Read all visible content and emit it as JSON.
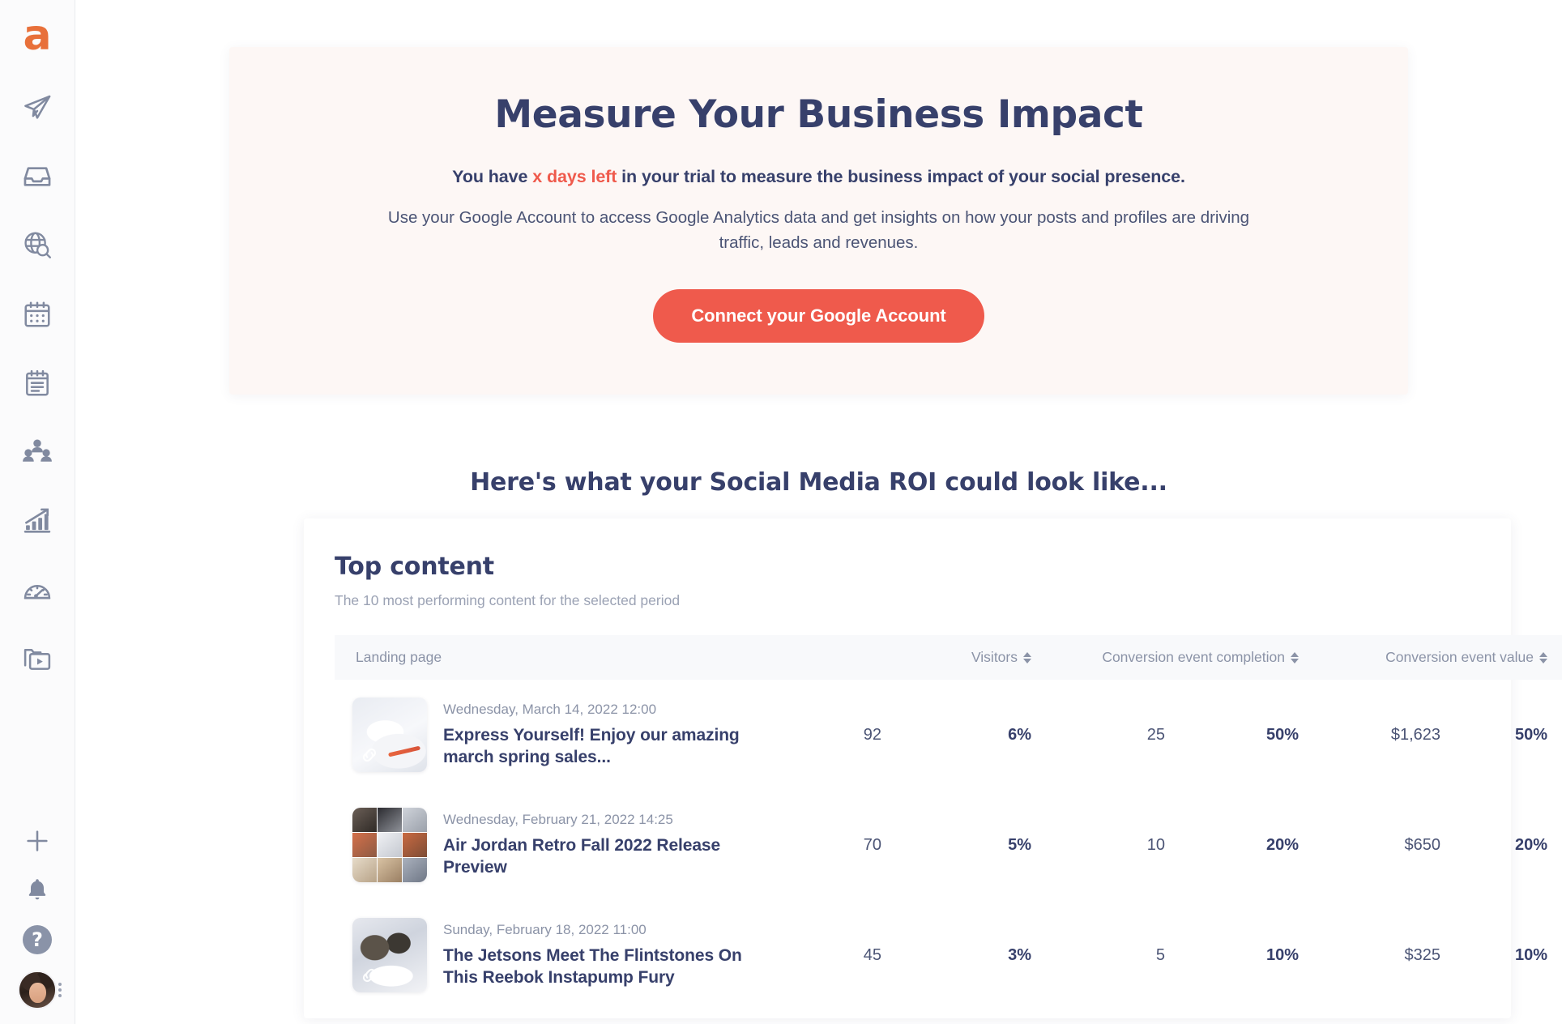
{
  "brand": {
    "logo_letter": "a",
    "logo_color": "#e8703a",
    "accent_color": "#ef5a4c",
    "heading_color": "#37406b"
  },
  "sidebar": {
    "items": [
      {
        "name": "publish-icon",
        "label": "Publish"
      },
      {
        "name": "inbox-icon",
        "label": "Inbox"
      },
      {
        "name": "listening-icon",
        "label": "Listening"
      },
      {
        "name": "calendar-icon",
        "label": "Calendar"
      },
      {
        "name": "notes-icon",
        "label": "Notes"
      },
      {
        "name": "audience-icon",
        "label": "Audience"
      },
      {
        "name": "analytics-icon",
        "label": "Analytics"
      },
      {
        "name": "performance-icon",
        "label": "Performance"
      },
      {
        "name": "media-library-icon",
        "label": "Media library"
      }
    ],
    "bottom": [
      {
        "name": "add-icon",
        "label": "Create"
      },
      {
        "name": "bell-icon",
        "label": "Notifications"
      },
      {
        "name": "help-icon",
        "label": "?"
      },
      {
        "name": "avatar",
        "label": "Account"
      }
    ]
  },
  "promo": {
    "title": "Measure Your Business Impact",
    "subtitle_before": "You have ",
    "subtitle_highlight": "x days left",
    "subtitle_after": " in your trial to measure the business impact of your social presence.",
    "description": "Use your Google Account to access Google Analytics data and get insights on how your posts and profiles are driving traffic, leads and revenues.",
    "cta_label": "Connect your Google Account"
  },
  "roi_heading": "Here's what your Social Media ROI could look like...",
  "top_content": {
    "title": "Top content",
    "subtitle": "The 10 most performing content for the selected period",
    "columns": [
      {
        "label": "Landing page",
        "sortable": false
      },
      {
        "label": "Visitors",
        "sortable": true
      },
      {
        "label": "Conversion event completion",
        "sortable": true
      },
      {
        "label": "Conversion event value",
        "sortable": true
      }
    ],
    "rows": [
      {
        "date": "Wednesday, March 14, 2022 12:00",
        "title": "Express Yourself! Enjoy our amazing march spring sales...",
        "visitors": "92",
        "visitors_pct": "6%",
        "conversions": "25",
        "conversions_pct": "50%",
        "value": "$1,623",
        "value_pct": "50%"
      },
      {
        "date": "Wednesday, February 21, 2022 14:25",
        "title": "Air Jordan Retro Fall 2022 Release Preview",
        "visitors": "70",
        "visitors_pct": "5%",
        "conversions": "10",
        "conversions_pct": "20%",
        "value": "$650",
        "value_pct": "20%"
      },
      {
        "date": "Sunday, February 18, 2022 11:00",
        "title": "The Jetsons Meet The Flintstones On This Reebok Instapump Fury",
        "visitors": "45",
        "visitors_pct": "3%",
        "conversions": "5",
        "conversions_pct": "10%",
        "value": "$325",
        "value_pct": "10%"
      }
    ]
  }
}
